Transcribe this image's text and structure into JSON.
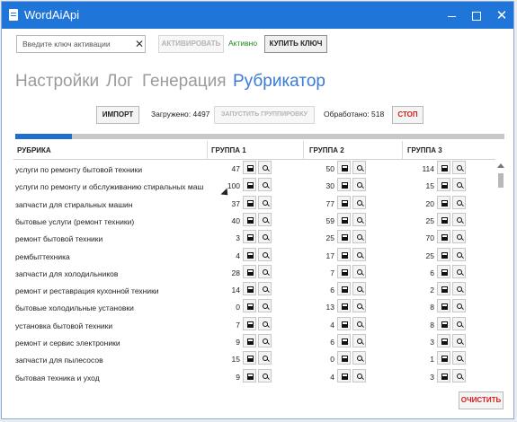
{
  "window": {
    "title": "WordAiApi"
  },
  "activation": {
    "key_placeholder": "Введите ключ активации",
    "activate_label": "АКТИВИРОВАТЬ",
    "status": "Активно",
    "buy_label": "КУПИТЬ КЛЮЧ"
  },
  "tabs": [
    "Настройки",
    "Лог",
    "Генерация",
    "Рубрикатор"
  ],
  "toolbar": {
    "import_label": "ИМПОРТ",
    "loaded": "Загружено: 4497",
    "group_label": "ЗАПУСТИТЬ ГРУППИРОВКУ",
    "processed": "Обработано: 518",
    "stop_label": "СТОП"
  },
  "progress": {
    "fraction": 0.115
  },
  "table": {
    "headers": [
      "РУБРИКА",
      "ГРУППА 1",
      "ГРУППА 2",
      "ГРУППА 3"
    ],
    "rows": [
      {
        "rubric": "услуги по ремонту бытовой техники",
        "g1": "47",
        "g2": "50",
        "g3": "114"
      },
      {
        "rubric": "услуги по ремонту и обслуживанию стиральных маш",
        "g1": "100",
        "g2": "30",
        "g3": "15"
      },
      {
        "rubric": "запчасти для стиральных машин",
        "g1": "37",
        "g2": "77",
        "g3": "20"
      },
      {
        "rubric": "бытовые услуги (ремонт техники)",
        "g1": "40",
        "g2": "59",
        "g3": "25"
      },
      {
        "rubric": "ремонт бытовой техники",
        "g1": "3",
        "g2": "25",
        "g3": "70"
      },
      {
        "rubric": "рембыттехника",
        "g1": "4",
        "g2": "17",
        "g3": "25"
      },
      {
        "rubric": "запчасти для холодильников",
        "g1": "28",
        "g2": "7",
        "g3": "6"
      },
      {
        "rubric": "ремонт и реставрация кухонной техники",
        "g1": "14",
        "g2": "6",
        "g3": "2"
      },
      {
        "rubric": "бытовые холодильные установки",
        "g1": "0",
        "g2": "13",
        "g3": "8"
      },
      {
        "rubric": "установка бытовой техники",
        "g1": "7",
        "g2": "4",
        "g3": "8"
      },
      {
        "rubric": "ремонт и сервис электроники",
        "g1": "9",
        "g2": "6",
        "g3": "3"
      },
      {
        "rubric": "запчасти для пылесосов",
        "g1": "15",
        "g2": "0",
        "g3": "1"
      },
      {
        "rubric": "бытовая техника и уход",
        "g1": "9",
        "g2": "4",
        "g3": "3"
      }
    ]
  },
  "footer": {
    "clear_label": "ОЧИСТИТЬ"
  },
  "icons": {
    "save": "save-icon",
    "search": "search-icon",
    "clear": "close-icon"
  }
}
